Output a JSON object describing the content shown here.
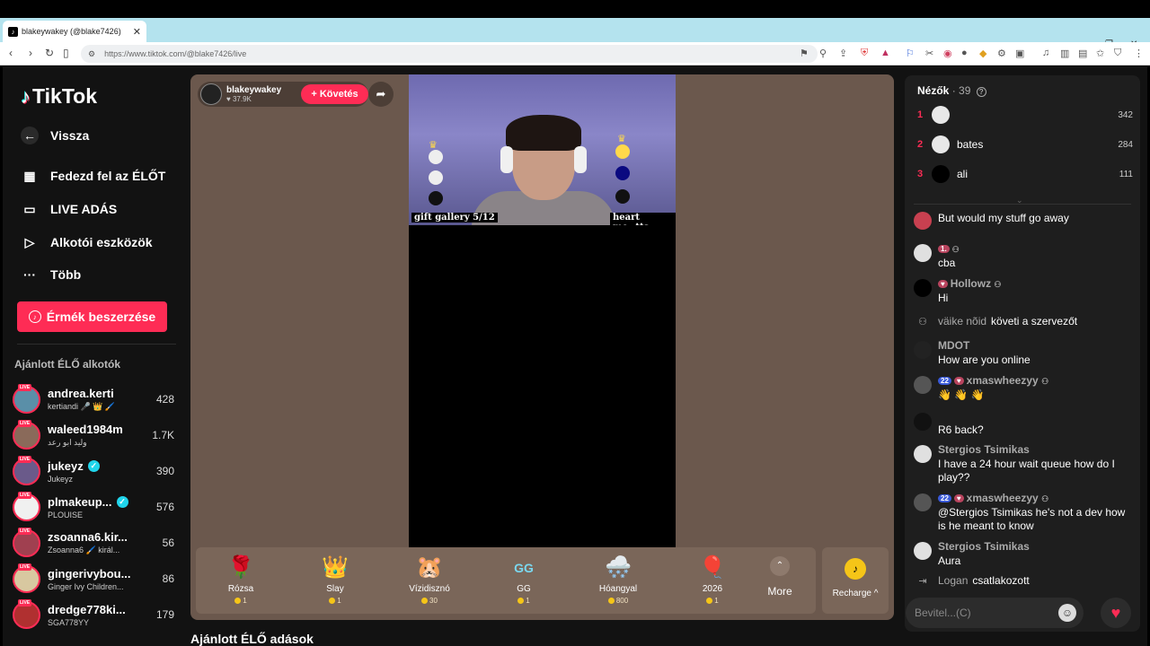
{
  "browser": {
    "tab_title": "blakeywakey (@blake7426)",
    "url": "https://www.tiktok.com/@blake7426/live"
  },
  "sidebar": {
    "logo": "TikTok",
    "back": "Vissza",
    "menu": [
      "Fedezd fel az ÉLŐT",
      "LIVE ADÁS",
      "Alkotói eszközök",
      "Több"
    ],
    "coins_button": "Érmék beszerzése",
    "recommended_title": "Ajánlott ÉLŐ alkotók",
    "live_badge": "LIVE",
    "creators": [
      {
        "name": "andrea.kerti",
        "sub": "kertiandi 🎤 👑 🖌️",
        "count": "428",
        "verified": false,
        "color": "#5a8fa8"
      },
      {
        "name": "waleed1984m",
        "sub": "وليد ابو رعد",
        "count": "1.7K",
        "verified": false,
        "color": "#8a6a5a"
      },
      {
        "name": "jukeyz",
        "sub": "Jukeyz",
        "count": "390",
        "verified": true,
        "color": "#6a5a8a"
      },
      {
        "name": "plmakeup...",
        "sub": "PLOUISE",
        "count": "576",
        "verified": true,
        "color": "#f0f0f0"
      },
      {
        "name": "zsoanna6.kir...",
        "sub": "Zsoanna6 🖌️ királ...",
        "count": "56",
        "verified": false,
        "color": "#a04050"
      },
      {
        "name": "gingerivybou...",
        "sub": "Ginger Ivy Children...",
        "count": "86",
        "verified": false,
        "color": "#d8c8a0"
      },
      {
        "name": "dredge778ki...",
        "sub": "SGA778YY",
        "count": "179",
        "verified": false,
        "color": "#b03030"
      }
    ]
  },
  "stage": {
    "host_name": "blakeywakey",
    "host_likes": "♥ 37.9K",
    "follow_label": "+ Követés",
    "cam_caption_left": "gift gallery 5/12",
    "cam_caption_right": "heart me=tts",
    "gifts": [
      {
        "name": "Rózsa",
        "price": "1",
        "icon": "🌹"
      },
      {
        "name": "Slay",
        "price": "1",
        "icon": "👑"
      },
      {
        "name": "Vízidisznó",
        "price": "30",
        "icon": "🐹"
      },
      {
        "name": "GG",
        "price": "1",
        "icon": "GG"
      },
      {
        "name": "Hóangyal",
        "price": "800",
        "icon": "🌨️"
      },
      {
        "name": "2026",
        "price": "1",
        "icon": "🎈"
      }
    ],
    "more_label": "More",
    "recharge_label": "Recharge ^",
    "below_title": "Ajánlott ÉLŐ adások"
  },
  "chat": {
    "viewers_label": "Nézők",
    "viewers_count": "· 39",
    "top_viewers": [
      {
        "rank": "1",
        "name": "",
        "score": "342",
        "color": "#e8e8e8"
      },
      {
        "rank": "2",
        "name": "bates",
        "score": "284",
        "color": "#e8e8e8"
      },
      {
        "rank": "3",
        "name": "ali",
        "score": "111",
        "color": "#000000"
      }
    ],
    "messages": [
      {
        "user": "",
        "text": "But would my stuff go away",
        "color": "#c84050"
      },
      {
        "user": "",
        "text": "cba",
        "color": "#e0e0e0"
      },
      {
        "user": "Hollowz",
        "text": "Hi",
        "color": "#000000"
      },
      {
        "user": "MDOT",
        "text": "How are you online",
        "color": "#222222"
      },
      {
        "user": "xmaswheezyy",
        "text": "👋 👋 👋",
        "color": "#555555"
      },
      {
        "user": "",
        "text": "R6 back?",
        "color": "#111111"
      },
      {
        "user": "Stergios Tsimikas",
        "text": "I have a 24 hour wait queue how do I play??",
        "color": "#e0e0e0"
      },
      {
        "user": "xmaswheezyy",
        "text": "@Stergios Tsimikas he's not a dev how is he meant to know",
        "color": "#555555"
      },
      {
        "user": "Stergios Tsimikas",
        "text": "Aura",
        "color": "#e0e0e0"
      }
    ],
    "system": [
      {
        "user": "väike nõid",
        "text": "követi a szervezőt"
      },
      {
        "user": "Logan",
        "text": "csatlakozott"
      }
    ],
    "badges": {
      "level": "22",
      "fan": "1."
    },
    "input_placeholder": "Bevitel...(C)"
  }
}
